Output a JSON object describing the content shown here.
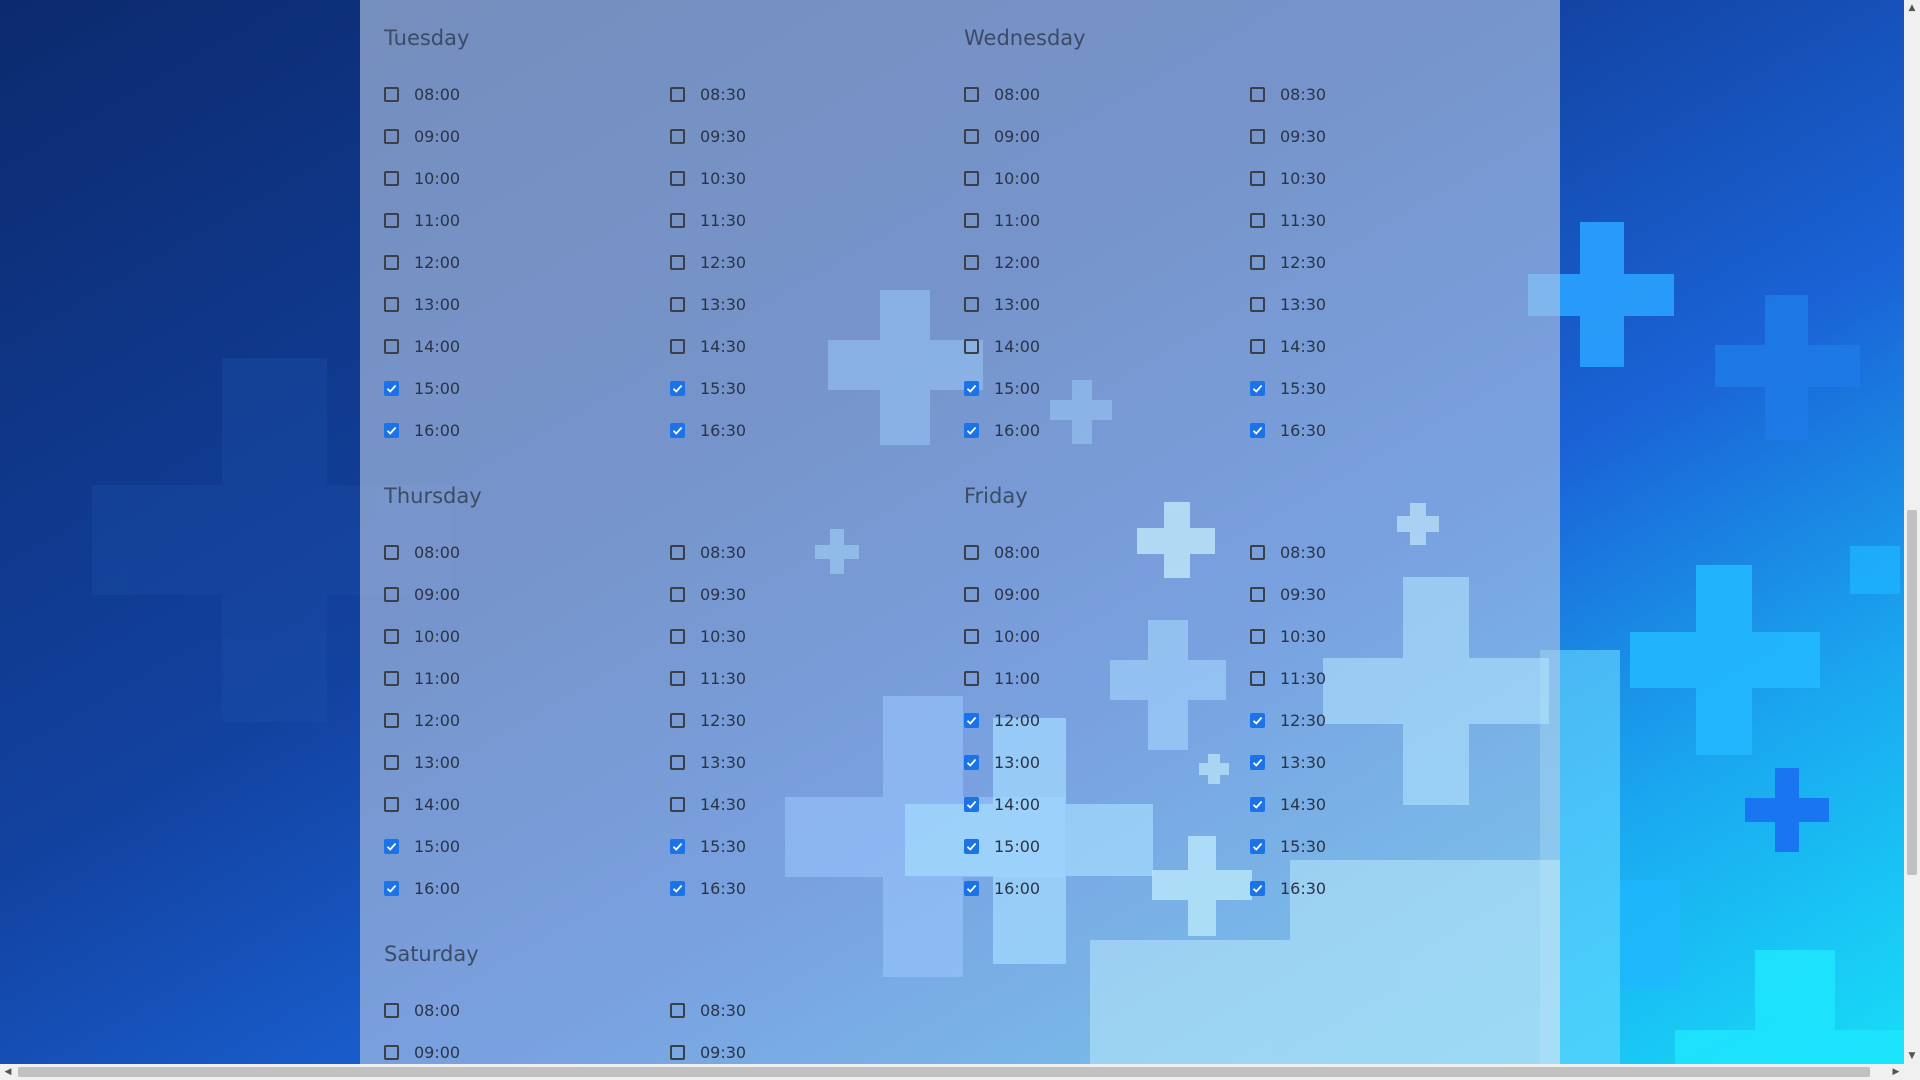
{
  "days": [
    {
      "name": "Tuesday",
      "slots_left": [
        [
          "08:00",
          false
        ],
        [
          "09:00",
          false
        ],
        [
          "10:00",
          false
        ],
        [
          "11:00",
          false
        ],
        [
          "12:00",
          false
        ],
        [
          "13:00",
          false
        ],
        [
          "14:00",
          false
        ],
        [
          "15:00",
          true
        ],
        [
          "16:00",
          true
        ]
      ],
      "slots_right": [
        [
          "08:30",
          false
        ],
        [
          "09:30",
          false
        ],
        [
          "10:30",
          false
        ],
        [
          "11:30",
          false
        ],
        [
          "12:30",
          false
        ],
        [
          "13:30",
          false
        ],
        [
          "14:30",
          false
        ],
        [
          "15:30",
          true
        ],
        [
          "16:30",
          true
        ]
      ]
    },
    {
      "name": "Wednesday",
      "slots_left": [
        [
          "08:00",
          false
        ],
        [
          "09:00",
          false
        ],
        [
          "10:00",
          false
        ],
        [
          "11:00",
          false
        ],
        [
          "12:00",
          false
        ],
        [
          "13:00",
          false
        ],
        [
          "14:00",
          false
        ],
        [
          "15:00",
          true
        ],
        [
          "16:00",
          true
        ]
      ],
      "slots_right": [
        [
          "08:30",
          false
        ],
        [
          "09:30",
          false
        ],
        [
          "10:30",
          false
        ],
        [
          "11:30",
          false
        ],
        [
          "12:30",
          false
        ],
        [
          "13:30",
          false
        ],
        [
          "14:30",
          false
        ],
        [
          "15:30",
          true
        ],
        [
          "16:30",
          true
        ]
      ]
    },
    {
      "name": "Thursday",
      "slots_left": [
        [
          "08:00",
          false
        ],
        [
          "09:00",
          false
        ],
        [
          "10:00",
          false
        ],
        [
          "11:00",
          false
        ],
        [
          "12:00",
          false
        ],
        [
          "13:00",
          false
        ],
        [
          "14:00",
          false
        ],
        [
          "15:00",
          true
        ],
        [
          "16:00",
          true
        ]
      ],
      "slots_right": [
        [
          "08:30",
          false
        ],
        [
          "09:30",
          false
        ],
        [
          "10:30",
          false
        ],
        [
          "11:30",
          false
        ],
        [
          "12:30",
          false
        ],
        [
          "13:30",
          false
        ],
        [
          "14:30",
          false
        ],
        [
          "15:30",
          true
        ],
        [
          "16:30",
          true
        ]
      ]
    },
    {
      "name": "Friday",
      "slots_left": [
        [
          "08:00",
          false
        ],
        [
          "09:00",
          false
        ],
        [
          "10:00",
          false
        ],
        [
          "11:00",
          false
        ],
        [
          "12:00",
          true
        ],
        [
          "13:00",
          true
        ],
        [
          "14:00",
          true
        ],
        [
          "15:00",
          true
        ],
        [
          "16:00",
          true
        ]
      ],
      "slots_right": [
        [
          "08:30",
          false
        ],
        [
          "09:30",
          false
        ],
        [
          "10:30",
          false
        ],
        [
          "11:30",
          false
        ],
        [
          "12:30",
          true
        ],
        [
          "13:30",
          true
        ],
        [
          "14:30",
          true
        ],
        [
          "15:30",
          true
        ],
        [
          "16:30",
          true
        ]
      ]
    },
    {
      "name": "Saturday",
      "slots_left": [
        [
          "08:00",
          false
        ],
        [
          "09:00",
          false
        ]
      ],
      "slots_right": [
        [
          "08:30",
          false
        ],
        [
          "09:30",
          false
        ]
      ]
    }
  ],
  "colors": {
    "checkbox_checked": "#1a73e8",
    "checkbox_border": "#3b3f47",
    "day_title": "#3c4b66",
    "slot_text": "#2b3447"
  },
  "scrollbar": {
    "up_arrow": "▲",
    "down_arrow": "▼",
    "left_arrow": "◀",
    "right_arrow": "▶"
  }
}
